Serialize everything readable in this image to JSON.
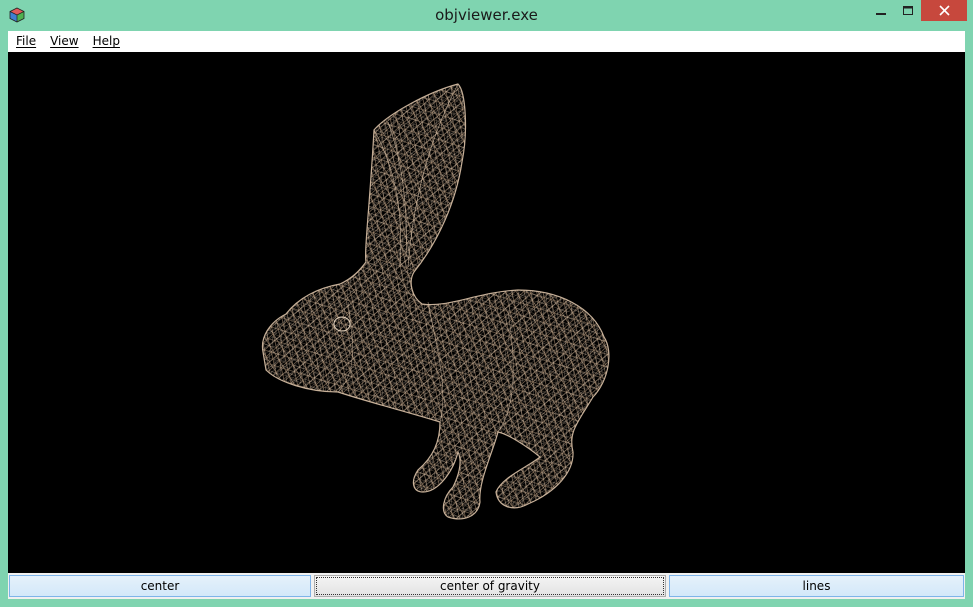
{
  "window": {
    "title": "objviewer.exe",
    "app_icon": "cube-app-icon",
    "controls": [
      "minimize-icon",
      "maximize-icon",
      "close-icon"
    ]
  },
  "menu": {
    "items": [
      {
        "label": "File",
        "mnemonic": "F"
      },
      {
        "label": "View",
        "mnemonic": "V"
      },
      {
        "label": "Help",
        "mnemonic": "H"
      }
    ]
  },
  "viewport": {
    "background": "#000000",
    "model": "rabbit",
    "render_mode": "wireframe",
    "wire_color": "#c8a888"
  },
  "buttons": {
    "center": "center",
    "center_of_gravity": "center of gravity",
    "lines": "lines"
  },
  "colors": {
    "titlebar": "#7fd4b0",
    "close_button": "#c7483d"
  }
}
